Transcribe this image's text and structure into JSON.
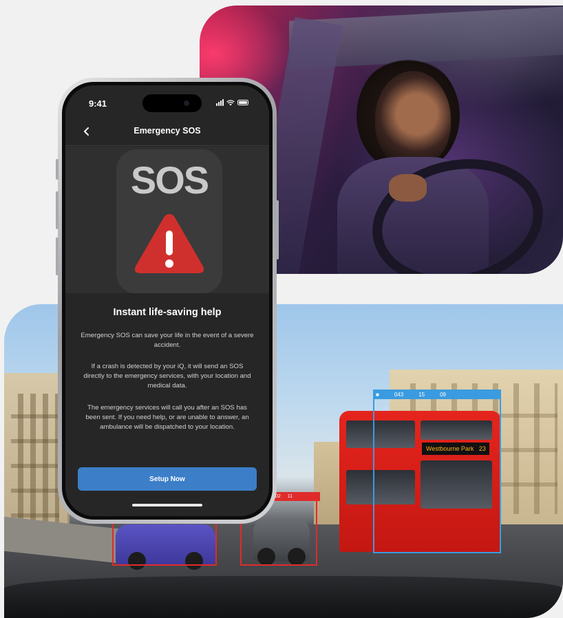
{
  "phone": {
    "status_bar": {
      "time": "9:41"
    },
    "nav": {
      "title": "Emergency SOS",
      "back_icon": "chevron-left-icon"
    },
    "hero": {
      "sos_label": "SOS",
      "warning_icon": "warning-triangle-icon",
      "colors": {
        "tile": "#3b3b3b",
        "warning": "#d0302d"
      }
    },
    "content": {
      "heading": "Instant life-saving help",
      "paragraph_1": "Emergency SOS can save your life in the event of a severe accident.",
      "paragraph_2": "If a crash is detected by your iQ,  it will send an SOS directly to the emergency services, with your location and medical data.",
      "paragraph_3": "The emergency services will call you after an SOS has been sent. If you need help, or are unable to answer, an ambulance will be dispatched to your location."
    },
    "cta": {
      "label": "Setup Now",
      "color": "#3c7fc8"
    }
  },
  "street_photo": {
    "bus_detection": {
      "a": "043",
      "b": "15",
      "c": "09"
    },
    "car_detection": {
      "speed": "02",
      "dist": "11"
    },
    "bus_destination": "Westbourne Park",
    "bus_route": "23"
  }
}
